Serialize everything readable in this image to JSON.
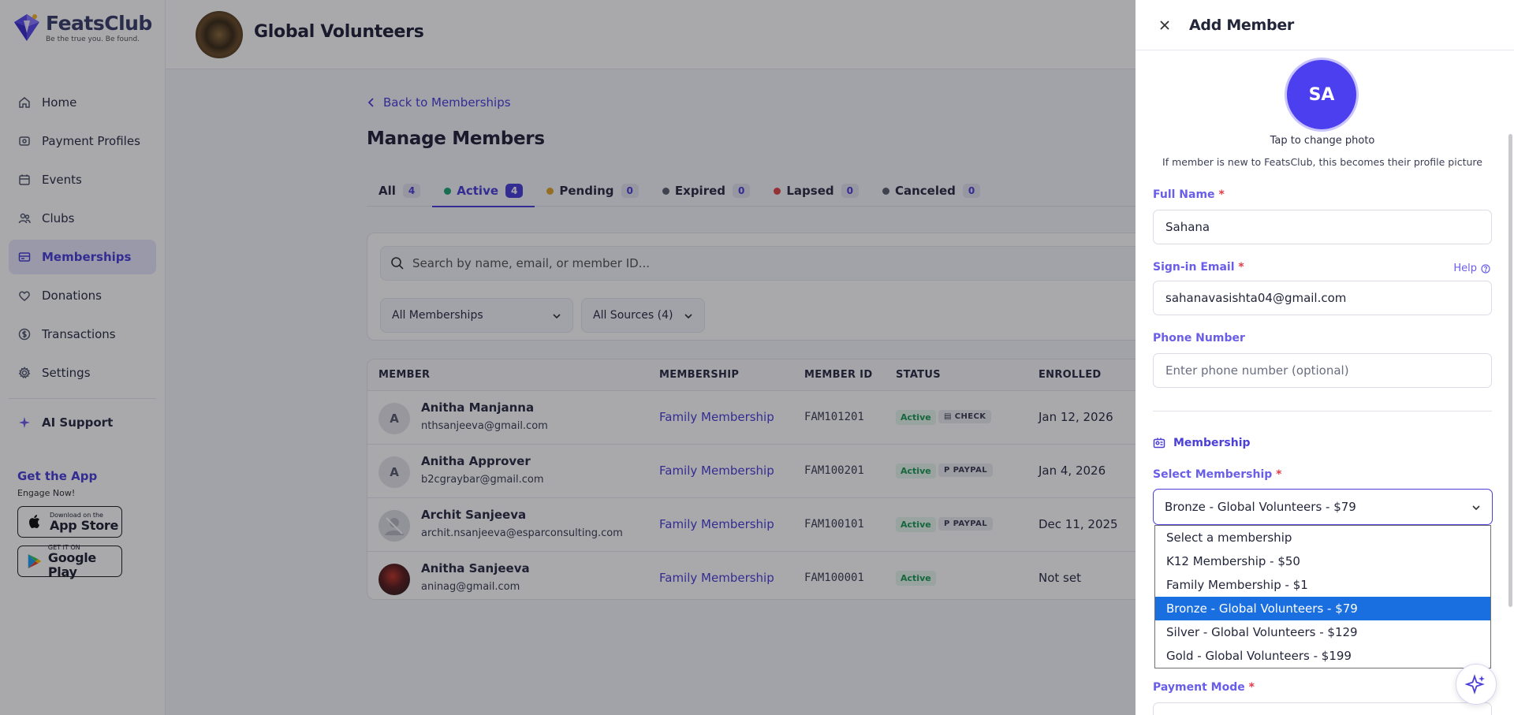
{
  "brand": {
    "name": "FeatsClub",
    "tagline": "Be the true you. Be found."
  },
  "sidebar": {
    "items": [
      {
        "label": "Home",
        "icon": "home-icon"
      },
      {
        "label": "Payment Profiles",
        "icon": "payment-profiles-icon"
      },
      {
        "label": "Events",
        "icon": "calendar-icon"
      },
      {
        "label": "Clubs",
        "icon": "clubs-icon"
      },
      {
        "label": "Memberships",
        "icon": "membership-card-icon",
        "active": true
      },
      {
        "label": "Donations",
        "icon": "heart-icon"
      },
      {
        "label": "Transactions",
        "icon": "dollar-icon"
      },
      {
        "label": "Settings",
        "icon": "gear-icon"
      }
    ],
    "ai_support": "AI Support",
    "get_app_title": "Get the App",
    "get_app_sub": "Engage Now!",
    "app_store_small": "Download on the",
    "app_store_big": "App Store",
    "play_small": "GET IT ON",
    "play_big": "Google Play"
  },
  "header": {
    "org_name": "Global Volunteers"
  },
  "main": {
    "back_link": "Back to Memberships",
    "title": "Manage Members",
    "tabs": [
      {
        "label": "All",
        "count": "4",
        "dot": ""
      },
      {
        "label": "Active",
        "count": "4",
        "dot": "#1ea672",
        "active": true
      },
      {
        "label": "Pending",
        "count": "0",
        "dot": "#e0a52b"
      },
      {
        "label": "Expired",
        "count": "0",
        "dot": "#5d6270"
      },
      {
        "label": "Lapsed",
        "count": "0",
        "dot": "#e04848"
      },
      {
        "label": "Canceled",
        "count": "0",
        "dot": "#5d6270"
      }
    ],
    "search_placeholder": "Search by name, email, or member ID...",
    "filter_membership": "All Memberships",
    "filter_sources": "All Sources (4)",
    "columns": [
      "MEMBER",
      "MEMBERSHIP",
      "MEMBER ID",
      "STATUS",
      "ENROLLED"
    ],
    "rows": [
      {
        "initial": "A",
        "name": "Anitha Manjanna",
        "email": "nthsanjeeva@gmail.com",
        "membership": "Family Membership",
        "member_id": "FAM101201",
        "status": "Active",
        "source": "CHECK",
        "enrolled": "Jan 12, 2026"
      },
      {
        "initial": "A",
        "name": "Anitha Approver",
        "email": "b2cgraybar@gmail.com",
        "membership": "Family Membership",
        "member_id": "FAM100201",
        "status": "Active",
        "source": "PAYPAL",
        "enrolled": "Jan 4, 2026"
      },
      {
        "initial": "",
        "name": "Archit Sanjeeva",
        "email": "archit.nsanjeeva@esparconsulting.com",
        "membership": "Family Membership",
        "member_id": "FAM100101",
        "status": "Active",
        "source": "PAYPAL",
        "enrolled": "Dec 11, 2025"
      },
      {
        "initial": "",
        "name": "Anitha Sanjeeva",
        "email": "aninag@gmail.com",
        "membership": "Family Membership",
        "member_id": "FAM100001",
        "status": "Active",
        "source": "",
        "enrolled": "Not set"
      }
    ]
  },
  "drawer": {
    "title": "Add Member",
    "avatar_initials": "SA",
    "tap_text": "Tap to change photo",
    "tap_sub": "If member is new to FeatsClub, this becomes their profile picture",
    "full_name_label": "Full Name",
    "full_name_value": "Sahana",
    "email_label": "Sign-in Email",
    "email_value": "sahanavasishta04@gmail.com",
    "help_label": "Help",
    "phone_label": "Phone Number",
    "phone_placeholder": "Enter phone number (optional)",
    "section_membership": "Membership",
    "select_membership_label": "Select Membership",
    "selected_membership": "Bronze - Global Volunteers - $79",
    "membership_options": [
      "Select a membership",
      "K12 Membership - $50",
      "Family Membership - $1",
      "Bronze - Global Volunteers - $79",
      "Silver - Global Volunteers - $129",
      "Gold - Global Volunteers - $199"
    ],
    "selected_index": 3,
    "payment_mode_label": "Payment Mode",
    "required_mark": "*"
  },
  "colors": {
    "accent": "#4b3fd8",
    "active_green": "#1c9a55",
    "selected_option": "#1a6fe0"
  }
}
